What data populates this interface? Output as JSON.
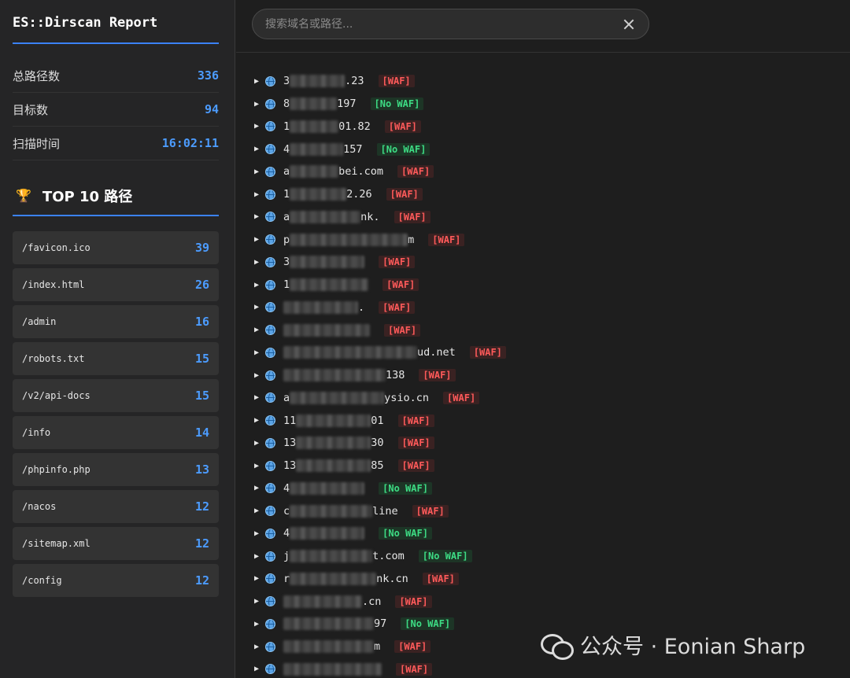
{
  "sidebar": {
    "title": "ES::Dirscan Report",
    "stats": [
      {
        "label": "总路径数",
        "value": "336"
      },
      {
        "label": "目标数",
        "value": "94"
      },
      {
        "label": "扫描时间",
        "value": "16:02:11"
      }
    ],
    "top_title": "TOP 10 路径",
    "top_icon": "trophy-icon",
    "top_paths": [
      {
        "path": "/favicon.ico",
        "count": "39"
      },
      {
        "path": "/index.html",
        "count": "26"
      },
      {
        "path": "/admin",
        "count": "16"
      },
      {
        "path": "/robots.txt",
        "count": "15"
      },
      {
        "path": "/v2/api-docs",
        "count": "15"
      },
      {
        "path": "/info",
        "count": "14"
      },
      {
        "path": "/phpinfo.php",
        "count": "13"
      },
      {
        "path": "/nacos",
        "count": "12"
      },
      {
        "path": "/sitemap.xml",
        "count": "12"
      },
      {
        "path": "/config",
        "count": "12"
      }
    ]
  },
  "search": {
    "placeholder": "搜索域名或路径..."
  },
  "targets": [
    {
      "visible_start": "3",
      "visible_end": ".23",
      "badge": "[WAF]",
      "waf": true
    },
    {
      "visible_start": "8",
      "visible_end": "197",
      "badge": "[No WAF]",
      "waf": false
    },
    {
      "visible_start": "1",
      "visible_end": "01.82",
      "badge": "[WAF]",
      "waf": true
    },
    {
      "visible_start": "4",
      "visible_end": "157",
      "badge": "[No WAF]",
      "waf": false
    },
    {
      "visible_start": "a",
      "visible_end": "bei.com",
      "badge": "[WAF]",
      "waf": true
    },
    {
      "visible_start": "1",
      "visible_end": "2.26",
      "badge": "[WAF]",
      "waf": true
    },
    {
      "visible_start": "a",
      "visible_end": "nk.",
      "badge": "[WAF]",
      "waf": true
    },
    {
      "visible_start": "p",
      "visible_end": "m",
      "badge": "[WAF]",
      "waf": true
    },
    {
      "visible_start": "3",
      "visible_end": "",
      "badge": "[WAF]",
      "waf": true
    },
    {
      "visible_start": "1",
      "visible_end": "",
      "badge": "[WAF]",
      "waf": true
    },
    {
      "visible_start": "",
      "visible_end": ".",
      "badge": "[WAF]",
      "waf": true
    },
    {
      "visible_start": "",
      "visible_end": "",
      "badge": "[WAF]",
      "waf": true
    },
    {
      "visible_start": "",
      "visible_end": "ud.net",
      "badge": "[WAF]",
      "waf": true
    },
    {
      "visible_start": "",
      "visible_end": "138",
      "badge": "[WAF]",
      "waf": true
    },
    {
      "visible_start": "a",
      "visible_end": "ysio.cn",
      "badge": "[WAF]",
      "waf": true
    },
    {
      "visible_start": "11",
      "visible_end": "01",
      "badge": "[WAF]",
      "waf": true
    },
    {
      "visible_start": "13",
      "visible_end": "30",
      "badge": "[WAF]",
      "waf": true
    },
    {
      "visible_start": "13",
      "visible_end": "85",
      "badge": "[WAF]",
      "waf": true
    },
    {
      "visible_start": "4",
      "visible_end": "",
      "badge": "[No WAF]",
      "waf": false
    },
    {
      "visible_start": "c",
      "visible_end": "line",
      "badge": "[WAF]",
      "waf": true
    },
    {
      "visible_start": "4",
      "visible_end": "",
      "badge": "[No WAF]",
      "waf": false
    },
    {
      "visible_start": "j",
      "visible_end": "t.com",
      "badge": "[No WAF]",
      "waf": false
    },
    {
      "visible_start": "r",
      "visible_end": "nk.cn",
      "badge": "[WAF]",
      "waf": true
    },
    {
      "visible_start": "",
      "visible_end": ".cn",
      "badge": "[WAF]",
      "waf": true
    },
    {
      "visible_start": "",
      "visible_end": "97",
      "badge": "[No WAF]",
      "waf": false
    },
    {
      "visible_start": "",
      "visible_end": "m",
      "badge": "[WAF]",
      "waf": true
    },
    {
      "visible_start": "",
      "visible_end": "",
      "badge": "[WAF]",
      "waf": true
    }
  ],
  "watermark": {
    "text": "公众号 · Eonian Sharp",
    "icon": "wechat-icon"
  },
  "colors": {
    "accent": "#3b82f6",
    "count": "#4c9cff",
    "waf": "#ff5a5a",
    "no_waf": "#3ddc84"
  }
}
